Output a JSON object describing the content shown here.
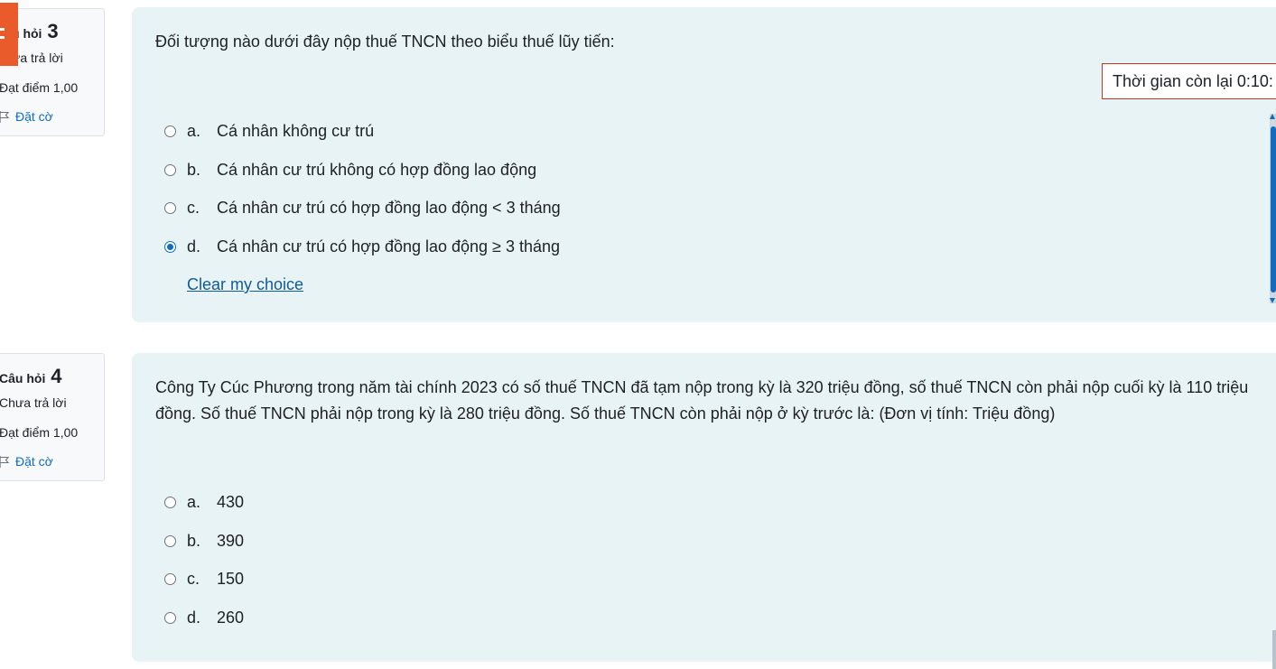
{
  "questions": [
    {
      "label": "Câu hỏi",
      "label_truncated": "u hỏi",
      "number": "3",
      "state": "Chưa trả lời",
      "state_truncated": "ưa trả lời",
      "grade": "Đạt điểm 1,00",
      "flag_label": "Đặt cờ",
      "text": "Đối tượng nào dưới đây nộp thuế TNCN theo biểu thuế lũy tiến:",
      "timer": "Thời gian còn lại 0:10:",
      "options": [
        {
          "letter": "a.",
          "text": "Cá nhân không cư trú",
          "selected": false
        },
        {
          "letter": "b.",
          "text": "Cá nhân cư trú không có hợp đồng lao động",
          "selected": false
        },
        {
          "letter": "c.",
          "text": "Cá nhân cư trú có hợp đồng lao động < 3 tháng",
          "selected": false
        },
        {
          "letter": "d.",
          "text": "Cá nhân cư trú có hợp đồng lao động ≥ 3 tháng",
          "selected": true
        }
      ],
      "clear_label": "Clear my choice"
    },
    {
      "label": "Câu hỏi",
      "number": "4",
      "state": "Chưa trả lời",
      "grade": "Đạt điểm 1,00",
      "flag_label": "Đặt cờ",
      "text": "Công Ty Cúc Phương trong năm tài chính 2023 có số thuế TNCN đã tạm nộp trong kỳ là 320 triệu đồng, số thuế TNCN còn phải nộp cuối kỳ là 110 triệu đồng. Số thuế TNCN phải nộp trong kỳ là 280 triệu đồng. Số thuế TNCN còn phải nộp ở kỳ trước là: (Đơn vị tính: Triệu đồng)",
      "options": [
        {
          "letter": "a.",
          "text": "430",
          "selected": false
        },
        {
          "letter": "b.",
          "text": "390",
          "selected": false
        },
        {
          "letter": "c.",
          "text": "150",
          "selected": false
        },
        {
          "letter": "d.",
          "text": "260",
          "selected": false
        }
      ]
    }
  ],
  "colors": {
    "content_bg": "#e7f3f5",
    "link": "#0f6cbf",
    "timer_border": "#ca3120",
    "tag": "#ea5b2c"
  }
}
